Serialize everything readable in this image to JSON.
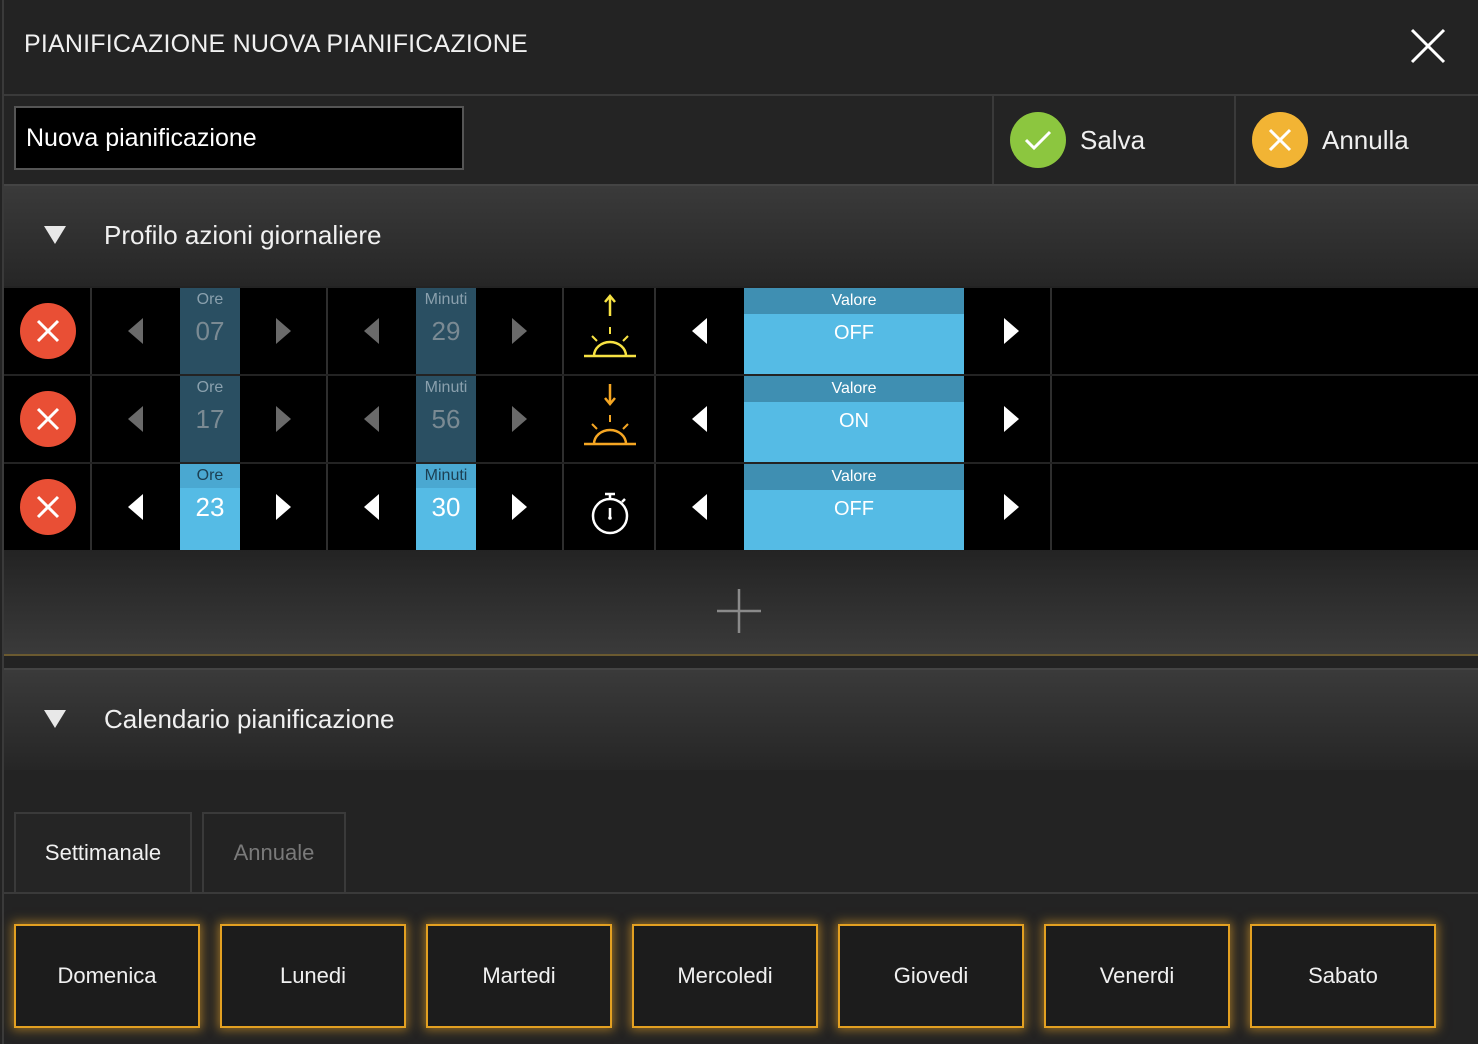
{
  "header": {
    "title": "PIANIFICAZIONE NUOVA PIANIFICAZIONE"
  },
  "name_field": {
    "value": "Nuova pianificazione"
  },
  "actions": {
    "save_label": "Salva",
    "cancel_label": "Annulla"
  },
  "colors": {
    "save": "#8cc63f",
    "cancel": "#f2b434",
    "delete": "#e94f35",
    "value_bg": "#55bbe5",
    "glow": "#e3a021"
  },
  "profile": {
    "title": "Profilo azioni giornaliere",
    "rows": [
      {
        "hours_label": "Ore",
        "hours": "07",
        "minutes_label": "Minuti",
        "minutes": "29",
        "icon": "sunrise-icon",
        "value_label": "Valore",
        "value": "OFF",
        "active": false
      },
      {
        "hours_label": "Ore",
        "hours": "17",
        "minutes_label": "Minuti",
        "minutes": "56",
        "icon": "sunset-icon",
        "value_label": "Valore",
        "value": "ON",
        "active": false
      },
      {
        "hours_label": "Ore",
        "hours": "23",
        "minutes_label": "Minuti",
        "minutes": "30",
        "icon": "timer-icon",
        "value_label": "Valore",
        "value": "OFF",
        "active": true
      }
    ]
  },
  "calendar": {
    "title": "Calendario pianificazione",
    "tabs": [
      {
        "label": "Settimanale",
        "selected": true
      },
      {
        "label": "Annuale",
        "selected": false
      }
    ],
    "days": [
      "Domenica",
      "Lunedi",
      "Martedi",
      "Mercoledi",
      "Giovedi",
      "Venerdi",
      "Sabato"
    ]
  }
}
